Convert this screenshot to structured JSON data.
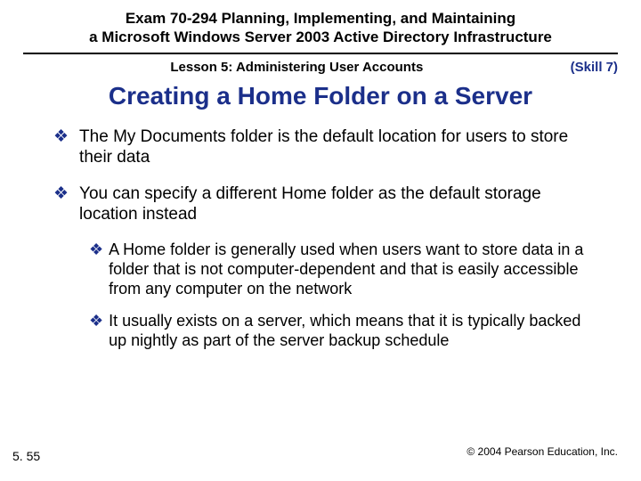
{
  "header": {
    "exam_title_line1": "Exam 70-294 Planning, Implementing, and Maintaining",
    "exam_title_line2": "a Microsoft Windows Server 2003 Active Directory Infrastructure",
    "lesson": "Lesson 5: Administering User Accounts",
    "skill": "(Skill 7)"
  },
  "slide": {
    "title": "Creating a Home Folder on a Server"
  },
  "bullets": {
    "b1": "The My Documents folder is the default location for users to store their data",
    "b2": "You can specify a different Home folder as the default storage location instead",
    "b2a": "A Home folder is generally used when users want to store data in a folder that is not computer-dependent and that is easily accessible from any computer on the network",
    "b2b": "It usually exists on a server, which means that it is typically backed up nightly as part of the server backup schedule"
  },
  "footer": {
    "page": "5. 55",
    "copyright": "© 2004 Pearson Education, Inc."
  },
  "marks": {
    "diamond": "❖"
  }
}
